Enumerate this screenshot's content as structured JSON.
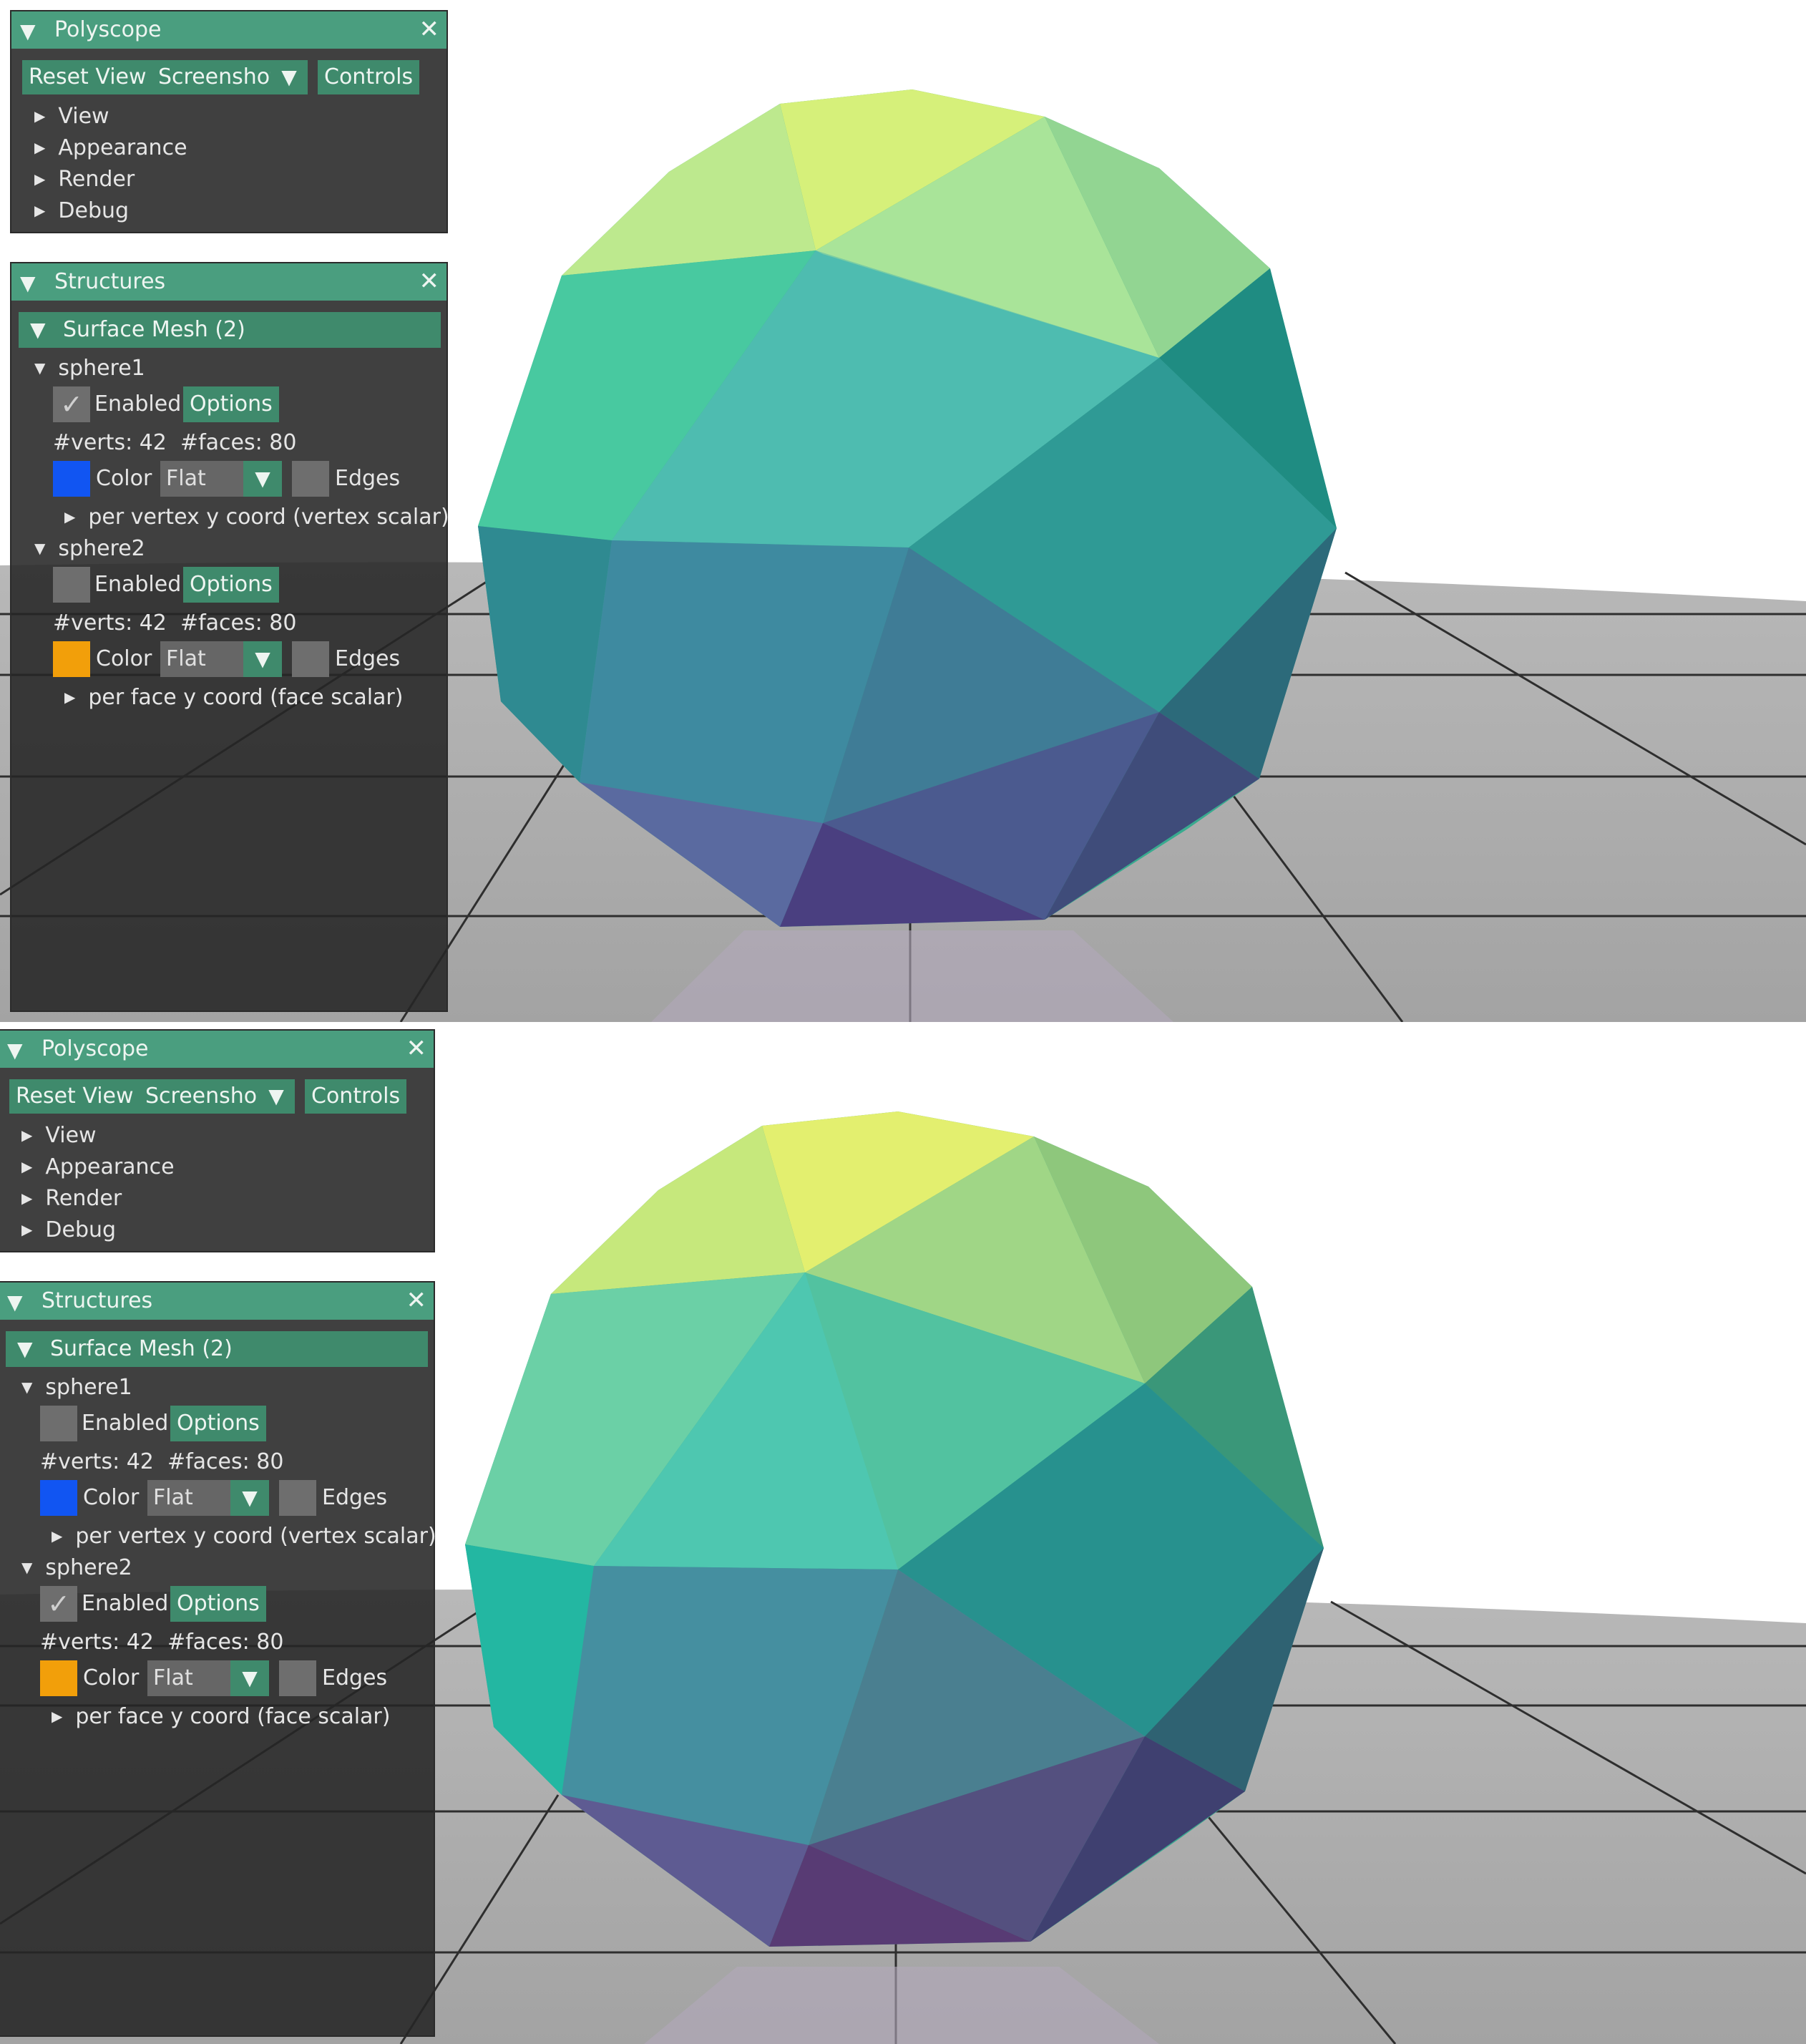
{
  "frames": [
    {
      "polyscope": {
        "title": "Polyscope",
        "buttons": {
          "reset": "Reset View",
          "screenshot": "Screenshot",
          "controls": "Controls"
        },
        "menu": [
          "View",
          "Appearance",
          "Render",
          "Debug"
        ]
      },
      "structures": {
        "title": "Structures",
        "group": "Surface Mesh (2)",
        "meshes": [
          {
            "name": "sphere1",
            "enabled": true,
            "enabled_label": "Enabled",
            "options": "Options",
            "stats": "#verts: 42  #faces: 80",
            "color_label": "Color",
            "color": "#1155f2",
            "shading": "Flat",
            "edges_label": "Edges",
            "quantity": "per vertex y coord (vertex scalar)"
          },
          {
            "name": "sphere2",
            "enabled": false,
            "enabled_label": "Enabled",
            "options": "Options",
            "stats": "#verts: 42  #faces: 80",
            "color_label": "Color",
            "color": "#f29f0a",
            "shading": "Flat",
            "edges_label": "Edges",
            "quantity": "per face y coord (face scalar)"
          }
        ]
      },
      "viewport_mesh": "sphere1"
    },
    {
      "polyscope": {
        "title": "Polyscope",
        "buttons": {
          "reset": "Reset View",
          "screenshot": "Screenshot",
          "controls": "Controls"
        },
        "menu": [
          "View",
          "Appearance",
          "Render",
          "Debug"
        ]
      },
      "structures": {
        "title": "Structures",
        "group": "Surface Mesh (2)",
        "meshes": [
          {
            "name": "sphere1",
            "enabled": false,
            "enabled_label": "Enabled",
            "options": "Options",
            "stats": "#verts: 42  #faces: 80",
            "color_label": "Color",
            "color": "#1155f2",
            "shading": "Flat",
            "edges_label": "Edges",
            "quantity": "per vertex y coord (vertex scalar)"
          },
          {
            "name": "sphere2",
            "enabled": true,
            "enabled_label": "Enabled",
            "options": "Options",
            "stats": "#verts: 42  #faces: 80",
            "color_label": "Color",
            "color": "#f29f0a",
            "shading": "Flat",
            "edges_label": "Edges",
            "quantity": "per face y coord (face scalar)"
          }
        ]
      },
      "viewport_mesh": "sphere2"
    }
  ],
  "icons": {
    "collapse": "triangle-down-icon",
    "expand": "triangle-right-icon",
    "close": "close-icon",
    "check": "checkmark-icon",
    "dropdown": "triangle-down-icon"
  },
  "colors": {
    "header": "#4a9e7f",
    "button": "#3f8a6c",
    "panel_bg": "#262626",
    "ground": "#a8a8a8",
    "colormap_low": "#453781",
    "colormap_mid": "#21918c",
    "colormap_high": "#e6ef5a"
  }
}
